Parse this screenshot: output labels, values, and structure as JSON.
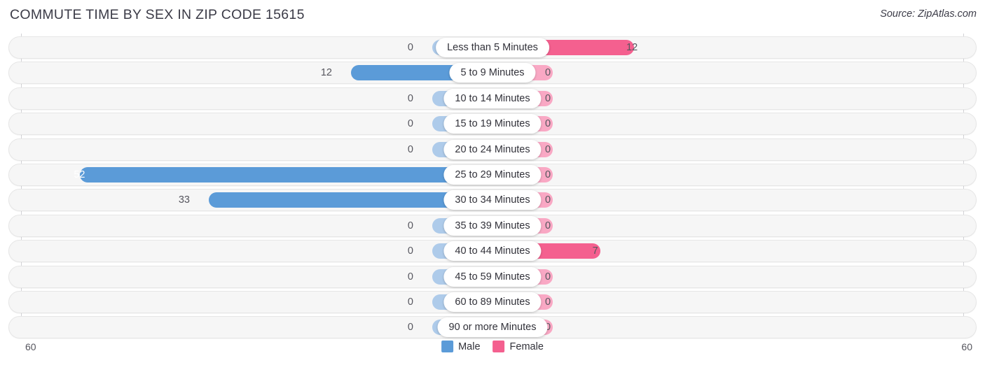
{
  "header": {
    "title": "COMMUTE TIME BY SEX IN ZIP CODE 15615",
    "source": "Source: ZipAtlas.com"
  },
  "legend": {
    "male_label": "Male",
    "female_label": "Female",
    "male_color": "#5b9bd8",
    "female_color": "#f4608f",
    "male_zero_color": "#aecbea",
    "female_zero_color": "#f9a8c4"
  },
  "axis": {
    "left_tick": "60",
    "right_tick": "60",
    "max": 60
  },
  "chart_data": {
    "type": "bar",
    "title": "COMMUTE TIME BY SEX IN ZIP CODE 15615",
    "xlabel": "",
    "ylabel": "",
    "orientation": "horizontal-diverging",
    "xlim": [
      60,
      60
    ],
    "grid": false,
    "legend_position": "bottom-center",
    "categories": [
      "Less than 5 Minutes",
      "5 to 9 Minutes",
      "10 to 14 Minutes",
      "15 to 19 Minutes",
      "20 to 24 Minutes",
      "25 to 29 Minutes",
      "30 to 34 Minutes",
      "35 to 39 Minutes",
      "40 to 44 Minutes",
      "45 to 59 Minutes",
      "60 to 89 Minutes",
      "90 or more Minutes"
    ],
    "series": [
      {
        "name": "Male",
        "values": [
          0,
          12,
          0,
          0,
          0,
          52,
          33,
          0,
          0,
          0,
          0,
          0
        ]
      },
      {
        "name": "Female",
        "values": [
          12,
          0,
          0,
          0,
          0,
          0,
          0,
          0,
          7,
          0,
          0,
          0
        ]
      }
    ]
  },
  "rows": [
    {
      "label": "Less than 5 Minutes",
      "male": 0,
      "female": 12,
      "male_text": "0",
      "female_text": "12"
    },
    {
      "label": "5 to 9 Minutes",
      "male": 12,
      "female": 0,
      "male_text": "12",
      "female_text": "0"
    },
    {
      "label": "10 to 14 Minutes",
      "male": 0,
      "female": 0,
      "male_text": "0",
      "female_text": "0"
    },
    {
      "label": "15 to 19 Minutes",
      "male": 0,
      "female": 0,
      "male_text": "0",
      "female_text": "0"
    },
    {
      "label": "20 to 24 Minutes",
      "male": 0,
      "female": 0,
      "male_text": "0",
      "female_text": "0"
    },
    {
      "label": "25 to 29 Minutes",
      "male": 52,
      "female": 0,
      "male_text": "52",
      "female_text": "0"
    },
    {
      "label": "30 to 34 Minutes",
      "male": 33,
      "female": 0,
      "male_text": "33",
      "female_text": "0"
    },
    {
      "label": "35 to 39 Minutes",
      "male": 0,
      "female": 0,
      "male_text": "0",
      "female_text": "0"
    },
    {
      "label": "40 to 44 Minutes",
      "male": 0,
      "female": 7,
      "male_text": "0",
      "female_text": "7"
    },
    {
      "label": "45 to 59 Minutes",
      "male": 0,
      "female": 0,
      "male_text": "0",
      "female_text": "0"
    },
    {
      "label": "60 to 89 Minutes",
      "male": 0,
      "female": 0,
      "male_text": "0",
      "female_text": "0"
    },
    {
      "label": "90 or more Minutes",
      "male": 0,
      "female": 0,
      "male_text": "0",
      "female_text": "0"
    }
  ]
}
